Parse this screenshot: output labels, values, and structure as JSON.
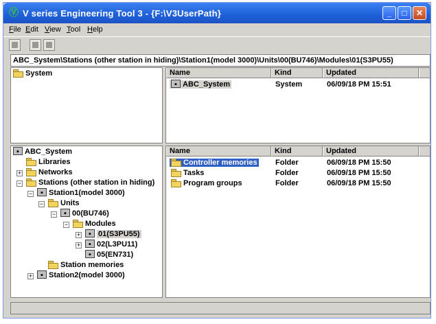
{
  "window": {
    "title": "V series Engineering Tool 3 - {F:\\V3UserPath}",
    "app_icon": "app-icon",
    "buttons": {
      "minimize": "_",
      "maximize": "□",
      "close": "✕"
    }
  },
  "menubar": {
    "items": [
      {
        "key": "F",
        "rest": "ile"
      },
      {
        "key": "E",
        "rest": "dit"
      },
      {
        "key": "V",
        "rest": "iew"
      },
      {
        "key": "T",
        "rest": "ool"
      },
      {
        "key": "H",
        "rest": "elp"
      }
    ]
  },
  "toolbar": {
    "buttons": [
      "new-icon",
      "copy-icon",
      "paste-icon"
    ]
  },
  "path": "ABC_System\\Stations (other station in hiding)\\Station1(model 3000)\\Units\\00(BU746)\\Modules\\01(S3PU55)",
  "top_left_tree": {
    "root": "System"
  },
  "top_right_list": {
    "columns": [
      "Name",
      "Kind",
      "Updated"
    ],
    "rows": [
      {
        "name": "ABC_System",
        "kind": "System",
        "updated": "06/09/18 PM 15:51"
      }
    ]
  },
  "tree": {
    "root": "ABC_System",
    "libraries": "Libraries",
    "networks": "Networks",
    "stations": "Stations (other station in hiding)",
    "station1": "Station1(model 3000)",
    "units": "Units",
    "unit00": "00(BU746)",
    "modules": "Modules",
    "mod01": "01(S3PU55)",
    "mod02": "02(L3PU11)",
    "mod05": "05(EN731)",
    "station_memories": "Station memories",
    "station2": "Station2(model 3000)"
  },
  "bottom_right_list": {
    "columns": [
      "Name",
      "Kind",
      "Updated"
    ],
    "rows": [
      {
        "name": "Controller memories",
        "kind": "Folder",
        "updated": "06/09/18 PM 15:50"
      },
      {
        "name": "Tasks",
        "kind": "Folder",
        "updated": "06/09/18 PM 15:50"
      },
      {
        "name": "Program groups",
        "kind": "Folder",
        "updated": "06/09/18 PM 15:50"
      }
    ]
  },
  "colors": {
    "title_bar": "#1f5fd8",
    "selection": "#3160c4",
    "folder": "#f2d35e"
  }
}
